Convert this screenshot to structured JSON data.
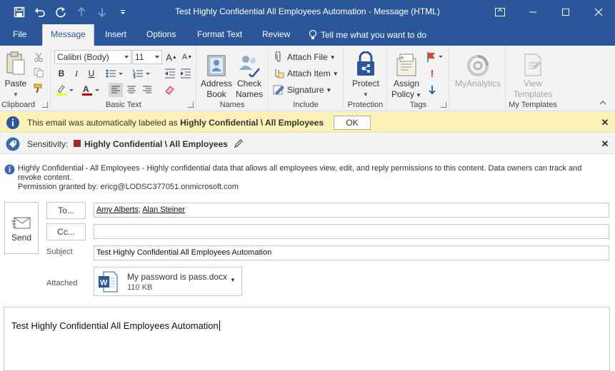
{
  "window": {
    "title": "Test Highly Confidential All Employees Automation  -  Message (HTML)"
  },
  "quick_access": {
    "save_icon": "save-icon",
    "undo_icon": "undo-icon",
    "redo_icon": "redo-icon",
    "up_icon": "arrow-up-icon",
    "down_icon": "arrow-down-icon",
    "customize_icon": "customize-qat-icon"
  },
  "tabs": [
    {
      "label": "File"
    },
    {
      "label": "Message"
    },
    {
      "label": "Insert"
    },
    {
      "label": "Options"
    },
    {
      "label": "Format Text"
    },
    {
      "label": "Review"
    }
  ],
  "tell_me": "Tell me what you want to do",
  "ribbon": {
    "clipboard": {
      "paste": "Paste",
      "label": "Clipboard"
    },
    "basic_text": {
      "font": "Calibri (Body)",
      "size": "11",
      "label": "Basic Text"
    },
    "names": {
      "address_book_1": "Address",
      "address_book_2": "Book",
      "check_names_1": "Check",
      "check_names_2": "Names",
      "label": "Names"
    },
    "include": {
      "attach_file": "Attach File",
      "attach_item": "Attach Item",
      "signature": "Signature",
      "label": "Include"
    },
    "protection": {
      "protect": "Protect",
      "label": "Protection"
    },
    "tags": {
      "assign_policy_1": "Assign",
      "assign_policy_2": "Policy",
      "label": "Tags"
    },
    "analytics": {
      "myanalytics": "MyAnalytics"
    },
    "templates": {
      "view_templates_1": "View",
      "view_templates_2": "Templates",
      "label": "My Templates"
    }
  },
  "infobar": {
    "prefix": "This email was automatically labeled as ",
    "label": "Highly Confidential \\ All Employees",
    "ok": "OK"
  },
  "sensitivity": {
    "caption": "Sensitivity:",
    "label": "Highly Confidential \\ All Employees",
    "color": "#a4262c"
  },
  "permission": {
    "line1": "Highly Confidential - All Employees - Highly confidential data that allows all employees view, edit, and reply permissions to this content. Data owners can track and revoke content.",
    "line2": "Permission granted by: ericg@LODSC377051.onmicrosoft.com"
  },
  "compose": {
    "send": "Send",
    "to_button": "To...",
    "cc_button": "Cc...",
    "to_recipients": [
      "Amy Alberts",
      "Alan Steiner"
    ],
    "cc_value": "",
    "subject_label": "Subject",
    "subject": "Test Highly Confidential All Employees Automation",
    "attached_label": "Attached",
    "attachment": {
      "name": "My password is pass.docx",
      "size": "110 KB"
    },
    "body": "Test Highly Confidential All Employees Automation"
  },
  "colors": {
    "brand": "#2b579a",
    "infobar": "#fcf2b8",
    "ribbon": "#f3f3f3"
  }
}
